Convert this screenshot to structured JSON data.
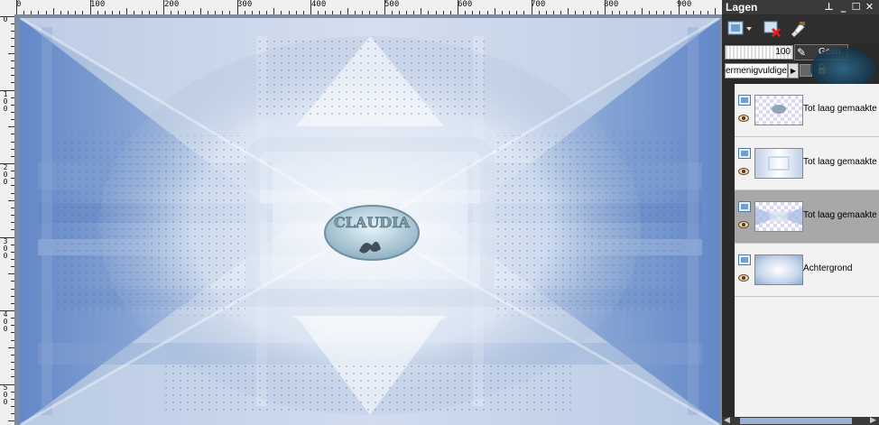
{
  "ruler": {
    "top_labels": [
      "0",
      "100",
      "200",
      "300",
      "400",
      "500",
      "600",
      "700",
      "800",
      "900"
    ],
    "left_labels": [
      "0",
      "100",
      "200",
      "300",
      "400",
      "500"
    ]
  },
  "canvas": {
    "watermark_text": "CLAUDIA"
  },
  "panel": {
    "title": "Lagen",
    "title_buttons": [
      "pin",
      "minimize",
      "maximize",
      "close"
    ],
    "opacity_value": "100",
    "blend_mode": "ermenigvuldige",
    "blend_mode_lock_label": "Geen",
    "layers": [
      {
        "name": "Tot laag gemaakte s",
        "visible": true,
        "selected": false,
        "thumb": "stamp"
      },
      {
        "name": "Tot laag gemaakte s",
        "visible": true,
        "selected": false,
        "thumb": "room"
      },
      {
        "name": "Tot laag gemaakte s",
        "visible": true,
        "selected": true,
        "thumb": "shapes"
      },
      {
        "name": "Achtergrond",
        "visible": true,
        "selected": false,
        "thumb": "background"
      }
    ]
  },
  "icons": {
    "new_layer": "new-raster-layer-icon",
    "delete_layer": "delete-layer-icon",
    "layer_properties": "layer-properties-icon",
    "visibility": "eye-icon",
    "layer_type": "raster-layer-icon"
  },
  "colors": {
    "canvas_light": "#eef3f9",
    "canvas_blue": "#5e86c8",
    "canvas_mid": "#a9bcd8",
    "panel_bg": "#2a2a2a",
    "selected_layer": "#a8a8a8"
  }
}
